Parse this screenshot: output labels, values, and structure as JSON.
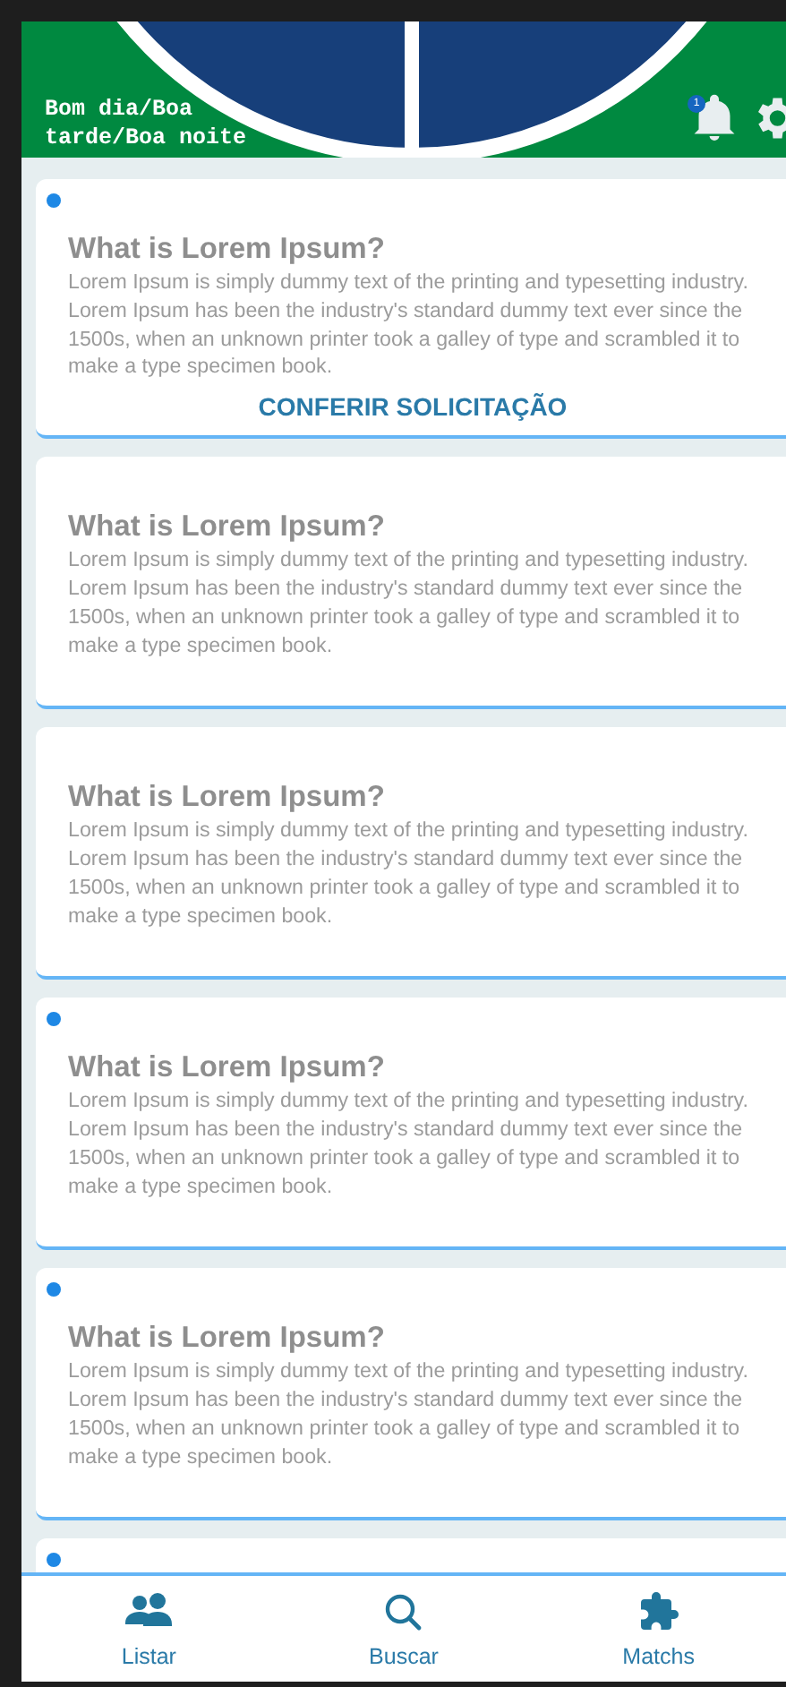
{
  "header": {
    "greeting": "Bom dia/Boa tarde/Boa noite",
    "notification_badge": "1"
  },
  "requests": [
    {
      "unread": true,
      "title": "What is Lorem Ipsum?",
      "body": "Lorem Ipsum is simply dummy text of the printing and typesetting industry. Lorem Ipsum has been the industry's standard dummy text ever since the 1500s, when an unknown printer took a galley of type and scrambled it to make a type specimen book.",
      "action": "CONFERIR SOLICITAÇÃO"
    },
    {
      "unread": false,
      "title": "What is Lorem Ipsum?",
      "body": "Lorem Ipsum is simply dummy text of the printing and typesetting industry. Lorem Ipsum has been the industry's standard dummy text ever since the 1500s, when an unknown printer took a galley of type and scrambled it to make a type specimen book."
    },
    {
      "unread": false,
      "title": "What is Lorem Ipsum?",
      "body": "Lorem Ipsum is simply dummy text of the printing and typesetting industry. Lorem Ipsum has been the industry's standard dummy text ever since the 1500s, when an unknown printer took a galley of type and scrambled it to make a type specimen book."
    },
    {
      "unread": true,
      "title": "What is Lorem Ipsum?",
      "body": "Lorem Ipsum is simply dummy text of the printing and typesetting industry. Lorem Ipsum has been the industry's standard dummy text ever since the 1500s, when an unknown printer took a galley of type and scrambled it to make a type specimen book."
    },
    {
      "unread": true,
      "title": "What is Lorem Ipsum?",
      "body": "Lorem Ipsum is simply dummy text of the printing and typesetting industry. Lorem Ipsum has been the industry's standard dummy text ever since the 1500s, when an unknown printer took a galley of type and scrambled it to make a type specimen book."
    },
    {
      "unread": true
    }
  ],
  "bottom_nav": [
    {
      "kind": "people",
      "label": "Listar"
    },
    {
      "kind": "search",
      "label": "Buscar"
    },
    {
      "kind": "puzzle",
      "label": "Matchs"
    }
  ]
}
